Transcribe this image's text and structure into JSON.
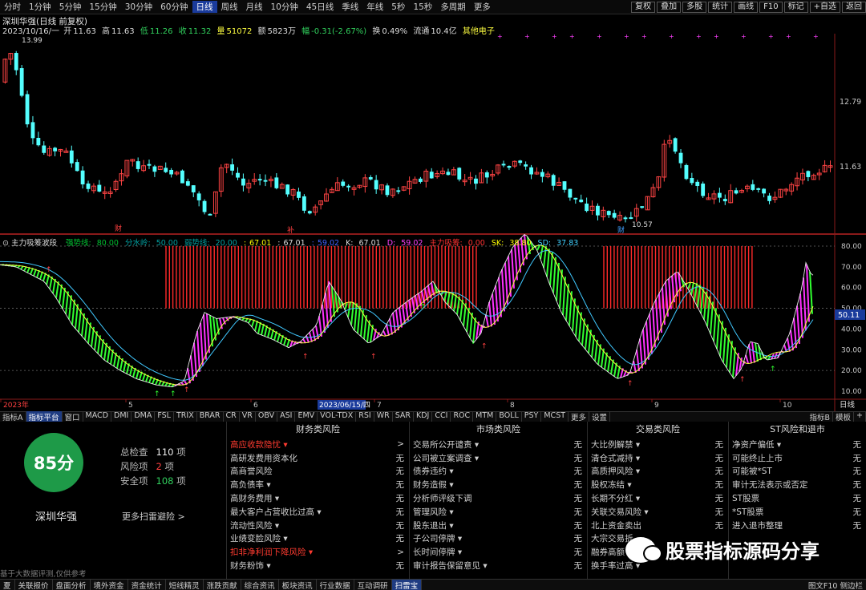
{
  "toolbar": {
    "timeframes": [
      "分时",
      "1分钟",
      "5分钟",
      "15分钟",
      "30分钟",
      "60分钟",
      "日线",
      "周线",
      "月线",
      "10分钟",
      "45日线",
      "季线",
      "年线",
      "5秒",
      "15秒",
      "多周期",
      "更多"
    ],
    "active_index": 6,
    "right_buttons": [
      "复权",
      "叠加",
      "多股",
      "统计",
      "画线",
      "F10",
      "标记",
      "+自选",
      "返回"
    ]
  },
  "title": "深圳华强(日线 前复权)",
  "quote": {
    "date": "2023/10/16/一",
    "open_label": "开",
    "open": "11.63",
    "high_label": "高",
    "high": "11.63",
    "low_label": "低",
    "low": "11.26",
    "close_label": "收",
    "close": "11.32",
    "volume_label": "量",
    "volume": "51072",
    "amount_label": "额",
    "amount": "5823万",
    "change_label": "幅",
    "change": "-0.31(-2.67%)",
    "turnover_label": "换",
    "turnover": "0.49%",
    "float_label": "流通",
    "float": "10.4亿",
    "sector": "其他电子"
  },
  "price_chart": {
    "axis_labels": [
      "12.79",
      "11.63"
    ],
    "high_marker": "13.99",
    "low_marker": "10.57",
    "markers": [
      "财",
      "补",
      "财"
    ]
  },
  "indicator": {
    "name": "主力吸筹波段",
    "params": [
      {
        "label": "强势线",
        "value": "80.00",
        "color": "#00c030"
      },
      {
        "label": "分水岭",
        "value": "50.00",
        "color": "#00a0a0"
      },
      {
        "label": "弱势线",
        "value": "20.00",
        "color": "#00a0a0"
      },
      {
        "label": "",
        "value": "67.01",
        "color": "#ffff00"
      },
      {
        "label": "",
        "value": "67.01",
        "color": "#dddddd"
      },
      {
        "label": "",
        "value": "59.02",
        "color": "#4060ff"
      },
      {
        "label": "K",
        "value": "67.01",
        "color": "#dddddd"
      },
      {
        "label": "D",
        "value": "59.02",
        "color": "#ff40ff"
      },
      {
        "label": "主力吸筹",
        "value": "0.00",
        "color": "#ff3030"
      },
      {
        "label": "SK",
        "value": "38.80",
        "color": "#ffff00"
      },
      {
        "label": "SD",
        "value": "37.83",
        "color": "#40d0ff"
      }
    ],
    "axis_labels": [
      "80.00",
      "70.00",
      "60.00",
      "50.00",
      "40.00",
      "30.00",
      "20.00",
      "10.00"
    ],
    "current_value": "50.11",
    "date_tag": "2023/06/15/四",
    "month_labels": [
      "2023年",
      "5",
      "6",
      "7",
      "8",
      "9",
      "10"
    ],
    "period_tag": "日线"
  },
  "indicator_tabs": [
    "指标A",
    "指标平台",
    "窗口",
    "MACD",
    "DMI",
    "DMA",
    "FSL",
    "TRIX",
    "BRAR",
    "CR",
    "VR",
    "OBV",
    "ASI",
    "EMV",
    "VOL-TDX",
    "RSI",
    "WR",
    "SAR",
    "KDJ",
    "CCI",
    "ROC",
    "MTM",
    "BOLL",
    "PSY",
    "MCST",
    "更多",
    "设置"
  ],
  "indicator_tab_active": 1,
  "indicator_tabs_right": [
    "指标B",
    "模板",
    "+"
  ],
  "scan": {
    "score": "85分",
    "stock_name": "深圳华强",
    "total_label": "总检查",
    "total": "110",
    "total_unit": "项",
    "risk_label": "风险项",
    "risk": "2",
    "risk_unit": "项",
    "safe_label": "安全项",
    "safe": "108",
    "safe_unit": "项",
    "more": "更多扫雷避险 >",
    "disclaimer": "基于大数据评测,仅供参考"
  },
  "risk_columns": [
    {
      "title": "财务类风险",
      "items": [
        {
          "name": "高应收款隐忧 ▾",
          "value": ">",
          "hl": true
        },
        {
          "name": "高研发费用资本化",
          "value": "无",
          "hl": false
        },
        {
          "name": "高商誉风险",
          "value": "无",
          "hl": false
        },
        {
          "name": "高负债率 ▾",
          "value": "无",
          "hl": false
        },
        {
          "name": "高财务费用 ▾",
          "value": "无",
          "hl": false
        },
        {
          "name": "最大客户占营收比过高 ▾",
          "value": "无",
          "hl": false
        },
        {
          "name": "流动性风险 ▾",
          "value": "无",
          "hl": false
        },
        {
          "name": "业绩变脸风险 ▾",
          "value": "无",
          "hl": false
        },
        {
          "name": "扣非净利润下降风险 ▾",
          "value": ">",
          "hl": true
        },
        {
          "name": "财务粉饰 ▾",
          "value": "无",
          "hl": false
        }
      ]
    },
    {
      "title": "市场类风险",
      "items": [
        {
          "name": "交易所公开谴责 ▾",
          "value": "无",
          "hl": false
        },
        {
          "name": "公司被立案调查 ▾",
          "value": "无",
          "hl": false
        },
        {
          "name": "债券违约 ▾",
          "value": "无",
          "hl": false
        },
        {
          "name": "财务造假 ▾",
          "value": "无",
          "hl": false
        },
        {
          "name": "分析师评级下调",
          "value": "无",
          "hl": false
        },
        {
          "name": "管理风险 ▾",
          "value": "无",
          "hl": false
        },
        {
          "name": "股东退出 ▾",
          "value": "无",
          "hl": false
        },
        {
          "name": "子公司停牌 ▾",
          "value": "无",
          "hl": false
        },
        {
          "name": "长时间停牌 ▾",
          "value": "无",
          "hl": false
        },
        {
          "name": "审计报告保留意见 ▾",
          "value": "无",
          "hl": false
        }
      ]
    },
    {
      "title": "交易类风险",
      "items": [
        {
          "name": "大比例解禁 ▾",
          "value": "无",
          "hl": false
        },
        {
          "name": "清仓式减持 ▾",
          "value": "无",
          "hl": false
        },
        {
          "name": "高质押风险 ▾",
          "value": "无",
          "hl": false
        },
        {
          "name": "股权冻结 ▾",
          "value": "无",
          "hl": false
        },
        {
          "name": "长期不分红 ▾",
          "value": "无",
          "hl": false
        },
        {
          "name": "关联交易风险 ▾",
          "value": "无",
          "hl": false
        },
        {
          "name": "北上资金卖出",
          "value": "无",
          "hl": false
        },
        {
          "name": "大宗交易折",
          "value": "",
          "hl": false
        },
        {
          "name": "融券高额",
          "value": "",
          "hl": false
        },
        {
          "name": "换手率过高 ▾",
          "value": "",
          "hl": false
        }
      ]
    },
    {
      "title": "ST风险和退市",
      "items": [
        {
          "name": "净资产偏低 ▾",
          "value": "无",
          "hl": false
        },
        {
          "name": "可能终止上市",
          "value": "无",
          "hl": false
        },
        {
          "name": "可能被*ST",
          "value": "无",
          "hl": false
        },
        {
          "name": "审计无法表示或否定",
          "value": "无",
          "hl": false
        },
        {
          "name": "ST股票",
          "value": "无",
          "hl": false
        },
        {
          "name": "*ST股票",
          "value": "无",
          "hl": false
        },
        {
          "name": "进入退市整理",
          "value": "无",
          "hl": false
        },
        {
          "name": "",
          "value": "",
          "hl": false
        },
        {
          "name": "",
          "value": "",
          "hl": false
        },
        {
          "name": "",
          "value": "",
          "hl": false
        }
      ]
    }
  ],
  "watermark": "股票指标源码分享",
  "bottom_nav": [
    "夏",
    "关联报价",
    "盘面分析",
    "境外资金",
    "资金统计",
    "短线精灵",
    "涨跌贡献",
    "综合资讯",
    "板块资讯",
    "行业数据",
    "互动调研",
    "扫雷宝"
  ],
  "bottom_nav_active": 11,
  "bottom_right": "图文F10 侧边栏"
}
